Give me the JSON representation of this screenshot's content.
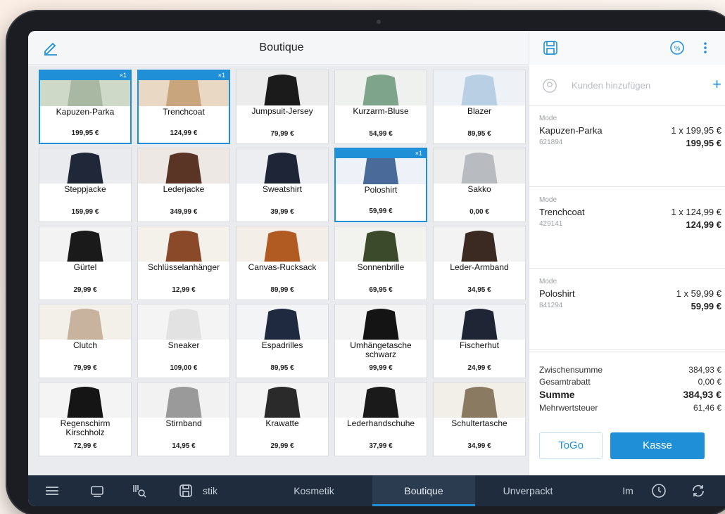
{
  "header": {
    "title": "Boutique"
  },
  "icons": {
    "edit": "pencil-icon",
    "save": "save-icon",
    "discount": "percent-icon",
    "more": "more-vertical-icon"
  },
  "colors": {
    "accent": "#1f8fd8",
    "bottom_bar": "#1f2c3d"
  },
  "products": [
    {
      "name": "Kapuzen-Parka",
      "price": "199,95 €",
      "badge": "×1",
      "selected": true
    },
    {
      "name": "Trenchcoat",
      "price": "124,99 €",
      "badge": "×1",
      "selected": true
    },
    {
      "name": "Jumpsuit-Jersey",
      "price": "79,99 €"
    },
    {
      "name": "Kurzarm-Bluse",
      "price": "54,99 €"
    },
    {
      "name": "Blazer",
      "price": "89,95 €"
    },
    {
      "name": "Steppjacke",
      "price": "159,99 €"
    },
    {
      "name": "Lederjacke",
      "price": "349,99 €"
    },
    {
      "name": "Sweatshirt",
      "price": "39,99 €"
    },
    {
      "name": "Poloshirt",
      "price": "59,99 €",
      "badge": "×1",
      "selected": true
    },
    {
      "name": "Sakko",
      "price": "0,00 €"
    },
    {
      "name": "Gürtel",
      "price": "29,99 €"
    },
    {
      "name": "Schlüsselanhänger",
      "price": "12,99 €"
    },
    {
      "name": "Canvas-Rucksack",
      "price": "89,99 €"
    },
    {
      "name": "Sonnenbrille",
      "price": "69,95 €"
    },
    {
      "name": "Leder-Armband",
      "price": "34,95 €"
    },
    {
      "name": "Clutch",
      "price": "79,99 €"
    },
    {
      "name": "Sneaker",
      "price": "109,00 €"
    },
    {
      "name": "Espadrilles",
      "price": "89,95 €"
    },
    {
      "name": "Umhängetasche schwarz",
      "price": "99,99 €"
    },
    {
      "name": "Fischerhut",
      "price": "24,99 €"
    },
    {
      "name": "Regenschirm Kirschholz",
      "price": "72,99 €"
    },
    {
      "name": "Stirnband",
      "price": "14,95 €"
    },
    {
      "name": "Krawatte",
      "price": "29,99 €"
    },
    {
      "name": "Lederhandschuhe",
      "price": "37,99 €"
    },
    {
      "name": "Schultertasche",
      "price": "34,99 €"
    }
  ],
  "customer": {
    "placeholder": "Kunden hinzufügen",
    "add": "+"
  },
  "cart": [
    {
      "category": "Mode",
      "name": "Kapuzen-Parka",
      "qty": "1 x 199,95 €",
      "sku": "621894",
      "total": "199,95 €"
    },
    {
      "category": "Mode",
      "name": "Trenchcoat",
      "qty": "1 x 124,99 €",
      "sku": "429141",
      "total": "124,99 €"
    },
    {
      "category": "Mode",
      "name": "Poloshirt",
      "qty": "1 x 59,99 €",
      "sku": "841294",
      "total": "59,99 €"
    }
  ],
  "totals": {
    "subtotal_label": "Zwischensumme",
    "subtotal": "384,93 €",
    "discount_label": "Gesamtrabatt",
    "discount": "0,00 €",
    "sum_label": "Summe",
    "sum": "384,93 €",
    "vat_label": "Mehrwertsteuer",
    "vat": "61,46 €"
  },
  "buttons": {
    "togo": "ToGo",
    "checkout": "Kasse"
  },
  "bottom_tabs": [
    {
      "label": "stik"
    },
    {
      "label": "Kosmetik"
    },
    {
      "label": "Boutique",
      "active": true
    },
    {
      "label": "Unverpackt"
    },
    {
      "label": "Im"
    }
  ]
}
